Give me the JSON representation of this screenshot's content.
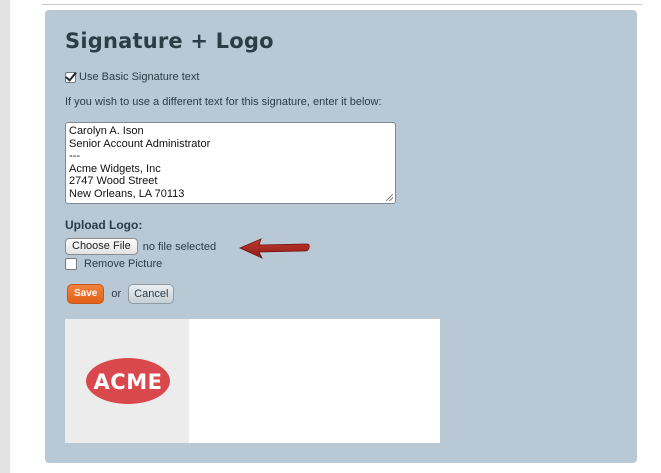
{
  "panel": {
    "title": "Signature + Logo",
    "use_basic_signature": {
      "label": "Use Basic Signature text",
      "checked": true
    },
    "hint": "If you wish to use a different text for this signature, enter it below:",
    "signature_lines": [
      "Carolyn A. Ison",
      "Senior Account Administrator",
      "---",
      "Acme Widgets, Inc",
      "2747 Wood Street",
      "New Orleans, LA 70113"
    ],
    "upload_logo_label": "Upload Logo:",
    "choose_file_label": "Choose File",
    "file_status": "no file selected",
    "remove_picture": {
      "label": "Remove Picture",
      "checked": false
    },
    "save_label": "Save",
    "or_label": "or",
    "cancel_label": "Cancel",
    "logo_text": "ACME"
  },
  "colors": {
    "panel_bg": "#b8c9d5",
    "save_orange": "#ec6f2a",
    "arrow_red": "#a3241c",
    "logo_red": "#d9484c"
  },
  "icons": [
    "checkbox-checked",
    "checkbox-unchecked",
    "red-arrow-pointer",
    "textarea-resize-grip"
  ]
}
